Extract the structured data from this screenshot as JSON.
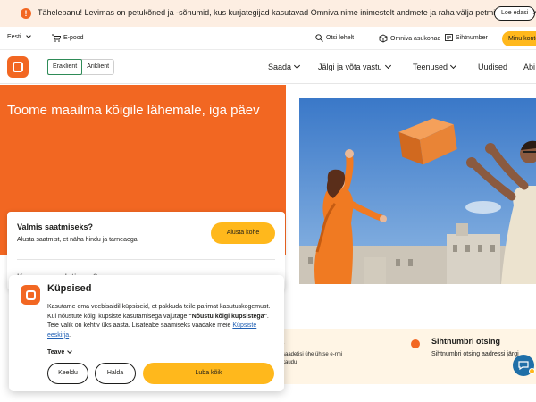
{
  "alert": {
    "icon": "exclamation-icon",
    "text": "Tähelepanu! Levimas on petukõned ja -sõnumid, kus kurjategijad kasutavad Omniva nime inimestelt andmete ja raha välja petmiseks.",
    "more_label": "Loe edasi",
    "close_icon": "×"
  },
  "utility": {
    "language": "Eesti",
    "eshop": "E-pood",
    "search": "Otsi lehelt",
    "contact": "Omniva asukohad",
    "zip": "Sihtnumber",
    "account": "Minu konto"
  },
  "nav": {
    "segments": [
      "Eraklient",
      "Äriklient"
    ],
    "active_segment": "Eraklient",
    "menu": [
      "Saada",
      "Jälgi ja võta vastu",
      "Teenused",
      "Uudised",
      "Abi"
    ]
  },
  "hero": {
    "title": "Toome maailma kõigile lähemale, iga päev"
  },
  "card": {
    "title": "Valmis saatmiseks?",
    "subtitle": "Alusta saatmist, et näha hindu ja tarneaega",
    "button": "Alusta kohe",
    "question": "Kus mu saadetis on?"
  },
  "services": {
    "first_title": "s",
    "first_desc": "saadetisi ühe ühtse e-rmi kaudu",
    "zip_title": "Sihtnumbri otsing",
    "zip_desc": "Sihtnumbri otsing aadressi järgi"
  },
  "cookie": {
    "title": "Küpsised",
    "body_1": "Kasutame oma veebisaidil küpsiseid, et pakkuda teile parimat kasutuskogemust. Kui nõustute kõigi küpsiste kasutamisega vajutage ",
    "body_bold": "\"Nõustu kõigi küpsistega\"",
    "body_2": ". Teie valik on kehtiv üks aasta. Lisateabe saamiseks vaadake meie ",
    "link": "Küpsiste eeskirja",
    "body_3": ".",
    "more": "Teave",
    "decline": "Keeldu",
    "manage": "Halda",
    "accept": "Luba kõik"
  },
  "colors": {
    "brand_orange": "#f26722",
    "accent_yellow": "#ffb81c",
    "alert_bg": "#fdeee2",
    "chat_blue": "#1f6fa8"
  }
}
